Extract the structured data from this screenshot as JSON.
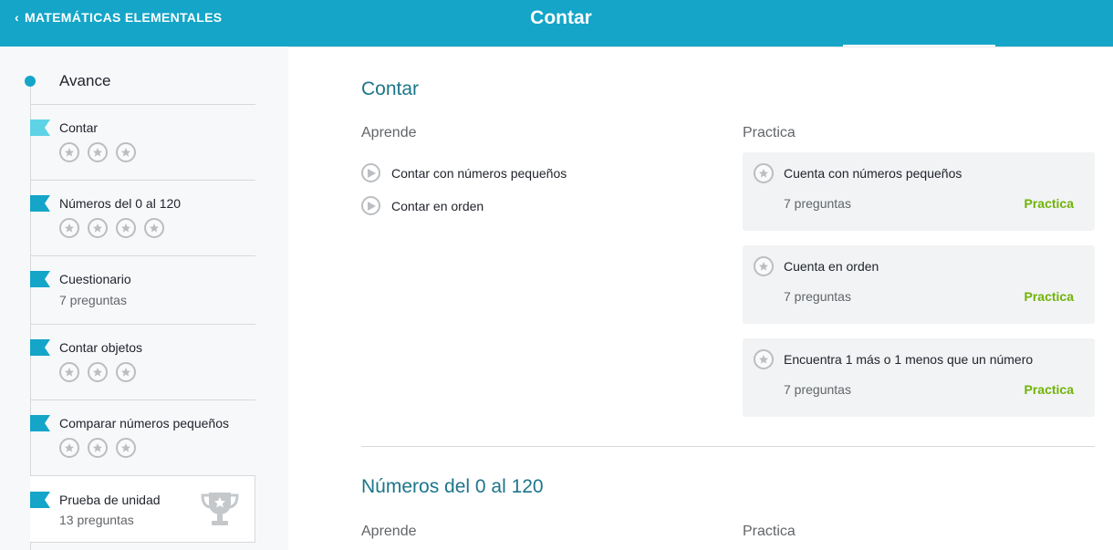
{
  "header": {
    "back_label": "MATEMÁTICAS ELEMENTALES",
    "title": "Contar",
    "bg_color": "#14a5c8"
  },
  "sidebar": {
    "progress_label": "Avance",
    "items": [
      {
        "label": "Contar",
        "stars": 3,
        "flag": "light"
      },
      {
        "label": "Números del 0 al 120",
        "stars": 4,
        "flag": "dark"
      },
      {
        "label": "Cuestionario",
        "sub": "7 preguntas",
        "flag": "dark"
      },
      {
        "label": "Contar objetos",
        "stars": 3,
        "flag": "dark"
      },
      {
        "label": "Comparar números pequeños",
        "stars": 3,
        "flag": "dark"
      }
    ],
    "unit_test": {
      "label": "Prueba de unidad",
      "sub": "13 preguntas",
      "icon": "trophy-icon"
    }
  },
  "main": {
    "sections": [
      {
        "title": "Contar",
        "learn_heading": "Aprende",
        "practice_heading": "Practica",
        "learn_items": [
          "Contar con números pequeños",
          "Contar en orden"
        ],
        "practice_items": [
          {
            "title": "Cuenta con números pequeños",
            "count": "7 preguntas",
            "action": "Practica"
          },
          {
            "title": "Cuenta en orden",
            "count": "7 preguntas",
            "action": "Practica"
          },
          {
            "title": "Encuentra 1 más o 1 menos que un número",
            "count": "7 preguntas",
            "action": "Practica"
          }
        ]
      },
      {
        "title": "Números del 0 al 120",
        "learn_heading": "Aprende",
        "practice_heading": "Practica"
      }
    ]
  },
  "colors": {
    "accent": "#14a5c8",
    "section_title": "#1c758a",
    "practice_link": "#71b307",
    "flag_light": "#5fd3e6",
    "flag_dark": "#14a5c8"
  }
}
